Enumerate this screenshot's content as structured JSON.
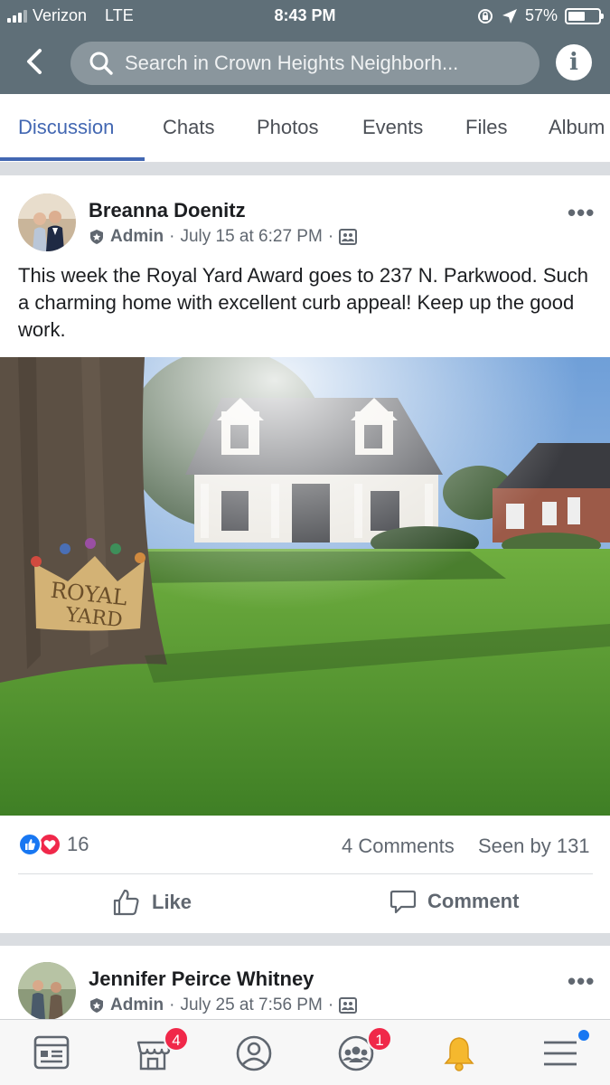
{
  "status_bar": {
    "carrier": "Verizon",
    "network": "LTE",
    "time": "8:43 PM",
    "battery": "57%",
    "battery_level": 0.57
  },
  "header": {
    "search_placeholder": "Search in Crown Heights Neighborh...",
    "info_label": "i"
  },
  "tabs": [
    {
      "label": "Discussion",
      "active": true
    },
    {
      "label": "Chats"
    },
    {
      "label": "Photos"
    },
    {
      "label": "Events"
    },
    {
      "label": "Files"
    },
    {
      "label": "Album"
    }
  ],
  "posts": [
    {
      "author": "Breanna Doenitz",
      "role": "Admin",
      "timestamp": "July 15 at 6:27 PM",
      "text": "This week the Royal Yard Award goes to 237 N. Parkwood. Such a charming home with excellent curb appeal! Keep up the good work.",
      "photo_sign": {
        "line1": "ROYAL",
        "line2": "YARD"
      },
      "reaction_count": "16",
      "comments": "4 Comments",
      "seen_by": "Seen by 131",
      "like_label": "Like",
      "comment_label": "Comment"
    },
    {
      "author": "Jennifer Peirce Whitney",
      "role": "Admin",
      "timestamp": "July 25 at 7:56 PM"
    }
  ],
  "bottom_nav": {
    "marketplace_badge": "4",
    "groups_badge": "1"
  },
  "colors": {
    "header_bg": "#5f6f78",
    "accent": "#4267b2",
    "badge": "#f02849",
    "like": "#1877f2",
    "love": "#f0284a"
  }
}
